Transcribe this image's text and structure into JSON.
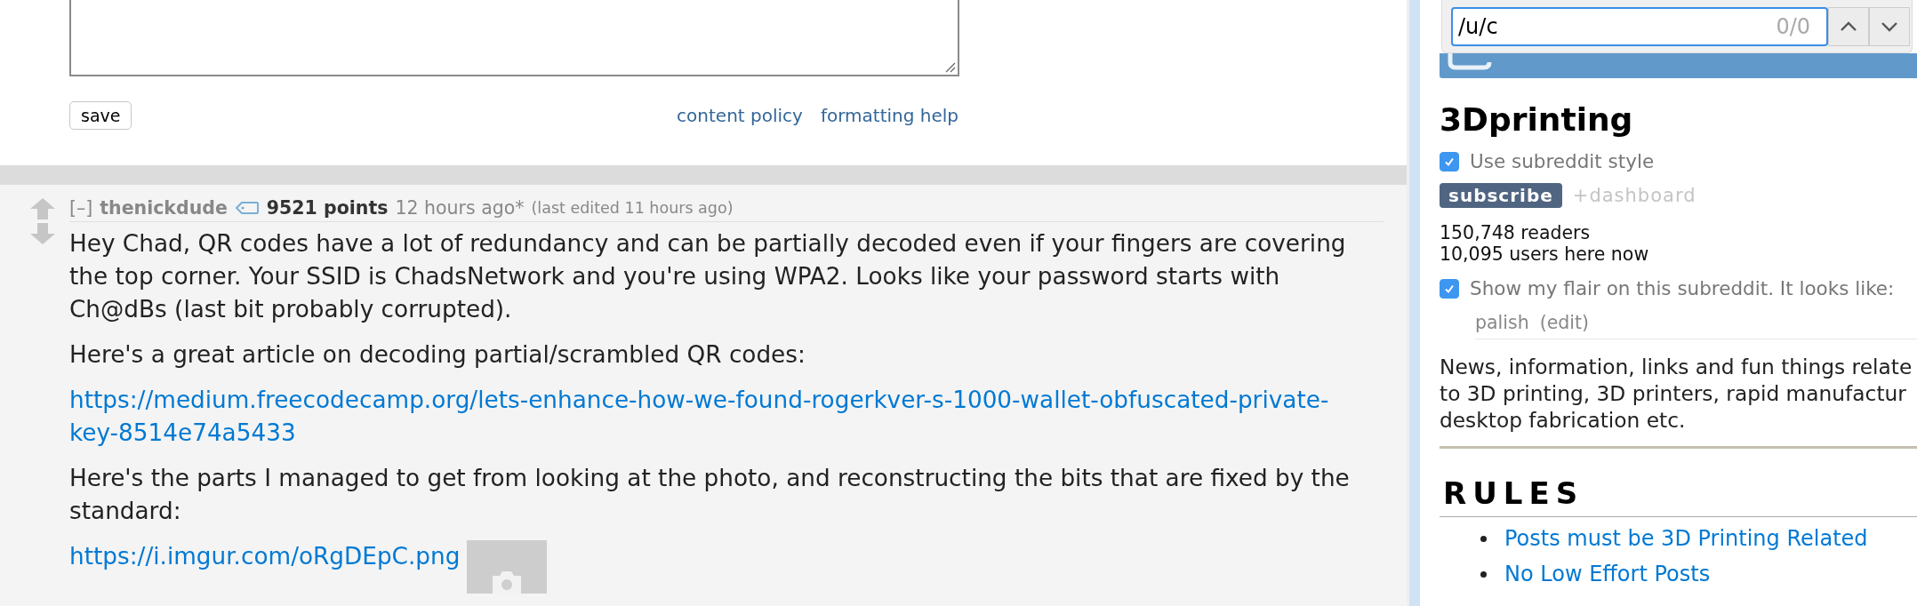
{
  "editor": {
    "save": "save",
    "links": [
      "content policy",
      "formatting help"
    ]
  },
  "comment": {
    "collapse": "[–]",
    "author": "thenickdude",
    "points": "9521 points",
    "time": "12 hours ago*",
    "edited": "(last edited 11 hours ago)",
    "paragraphs": [
      {
        "kind": "text",
        "text": "Hey Chad, QR codes have a lot of redundancy and can be partially decoded even if your fingers are covering the top corner. Your SSID is ChadsNetwork and you're using WPA2. Looks like your password starts with Ch@dBs (last bit probably corrupted)."
      },
      {
        "kind": "text",
        "text": "Here's a great article on decoding partial/scrambled QR codes:"
      },
      {
        "kind": "link",
        "text": "https://medium.freecodecamp.org/lets-enhance-how-we-found-rogerkver-s-1000-wallet-obfuscated-private-key-8514e74a5433"
      },
      {
        "kind": "text",
        "text": "Here's the parts I managed to get from looking at the photo, and reconstructing the bits that are fixed by the standard:"
      },
      {
        "kind": "image_link",
        "text": "https://i.imgur.com/oRgDEpC.png"
      }
    ]
  },
  "find_bar": {
    "value": "/u/c",
    "count": "0/0"
  },
  "sidebar": {
    "title": "3Dprinting",
    "style_option": {
      "label": "Use subreddit style",
      "checked": true
    },
    "subscribe": "subscribe",
    "dashboard": "+dashboard",
    "readers": "150,748 readers",
    "online": "10,095 users here now",
    "flair_option": {
      "label": "Show my flair on this subreddit. It looks like:",
      "checked": true
    },
    "flair": "palish",
    "flair_edit": "(edit)",
    "description_lines": [
      "News, information, links and fun things relate",
      "to 3D printing, 3D printers, rapid manufactur",
      "desktop fabrication etc."
    ],
    "rules_title": "RULES",
    "rules": [
      "Posts must be 3D Printing Related",
      "No Low Effort Posts"
    ]
  }
}
